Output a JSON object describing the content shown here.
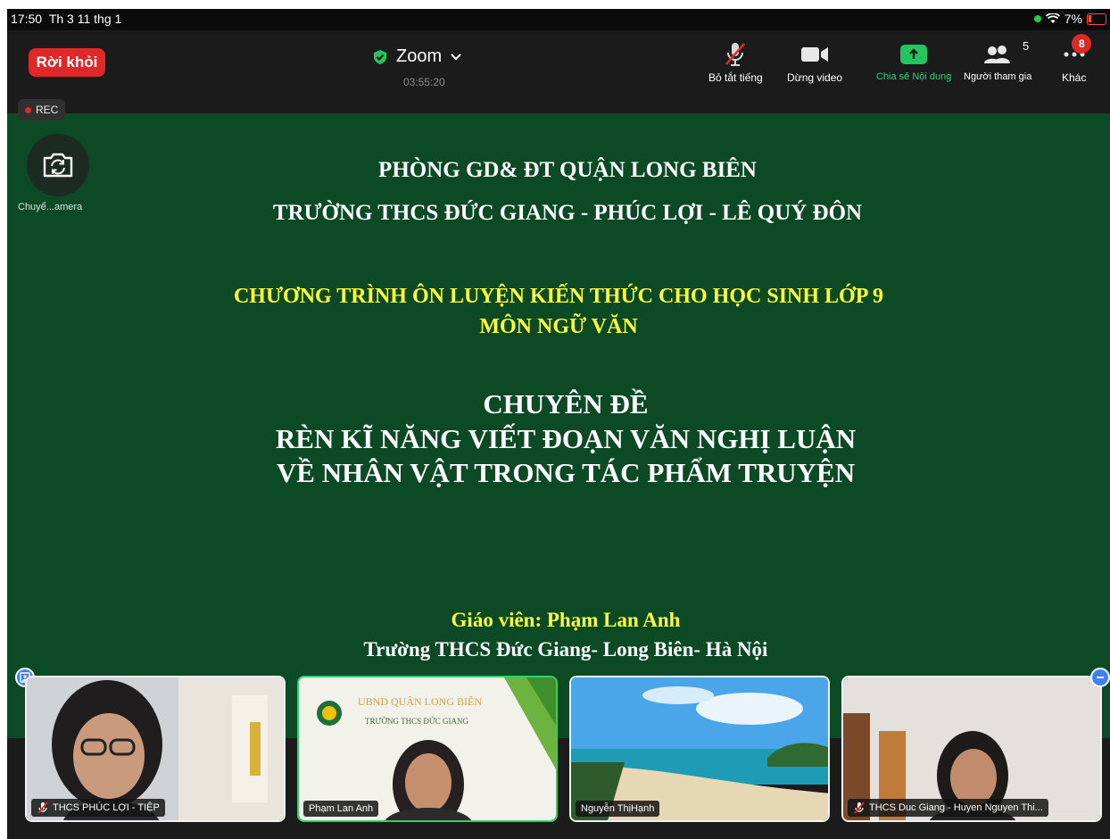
{
  "status_bar": {
    "time": "17:50",
    "date": "Th 3 11 thg 1",
    "battery": "7%"
  },
  "toolbar": {
    "leave_label": "Rời khỏi",
    "meeting_name": "Zoom",
    "timer": "03:55:20",
    "mute_label": "Bỏ tắt tiếng",
    "video_label": "Dừng video",
    "share_label": "Chia sẻ Nội dung",
    "participants_label": "Người tham gia",
    "participants_count": "5",
    "more_label": "Khác",
    "more_badge": "8"
  },
  "rec": {
    "label": "REC"
  },
  "camera": {
    "label": "Chuyể...amera"
  },
  "slide": {
    "line1": "PHÒNG GD& ĐT QUẬN LONG BIÊN",
    "line2": "TRƯỜNG THCS ĐỨC GIANG - PHÚC LỢI - LÊ QUÝ ĐÔN",
    "line3": "CHƯƠNG TRÌNH ÔN LUYỆN KIẾN THỨC CHO HỌC SINH LỚP  9",
    "line4": "MÔN NGỮ VĂN",
    "line5": "CHUYÊN ĐỀ",
    "line6": "RÈN KĨ NĂNG VIẾT ĐOẠN VĂN NGHỊ LUẬN",
    "line7": "VỀ  NHÂN VẬT TRONG TÁC PHẨM TRUYỆN",
    "line8": "Giáo viên: Phạm Lan Anh",
    "line9": "Trường THCS Đức Giang- Long Biên- Hà Nội"
  },
  "participants": [
    {
      "name": "THCS PHÚC LỢI - TIỆP",
      "muted": true
    },
    {
      "name": "Phạm Lan Anh",
      "muted": false,
      "vb_line1": "UBND QUẬN LONG BIÊN",
      "vb_line2": "TRƯỜNG THCS ĐỨC GIANG"
    },
    {
      "name": "Nguyễn ThịHạnh",
      "muted": false
    },
    {
      "name": "THCS Duc Giang - Huyen Nguyen Thi...",
      "muted": true
    }
  ],
  "colors": {
    "slide_bg": "#0b4a24",
    "leave": "#e02828",
    "share": "#22c55e",
    "slide_yellow": "#ffff33",
    "active_border": "#2ed26b"
  }
}
